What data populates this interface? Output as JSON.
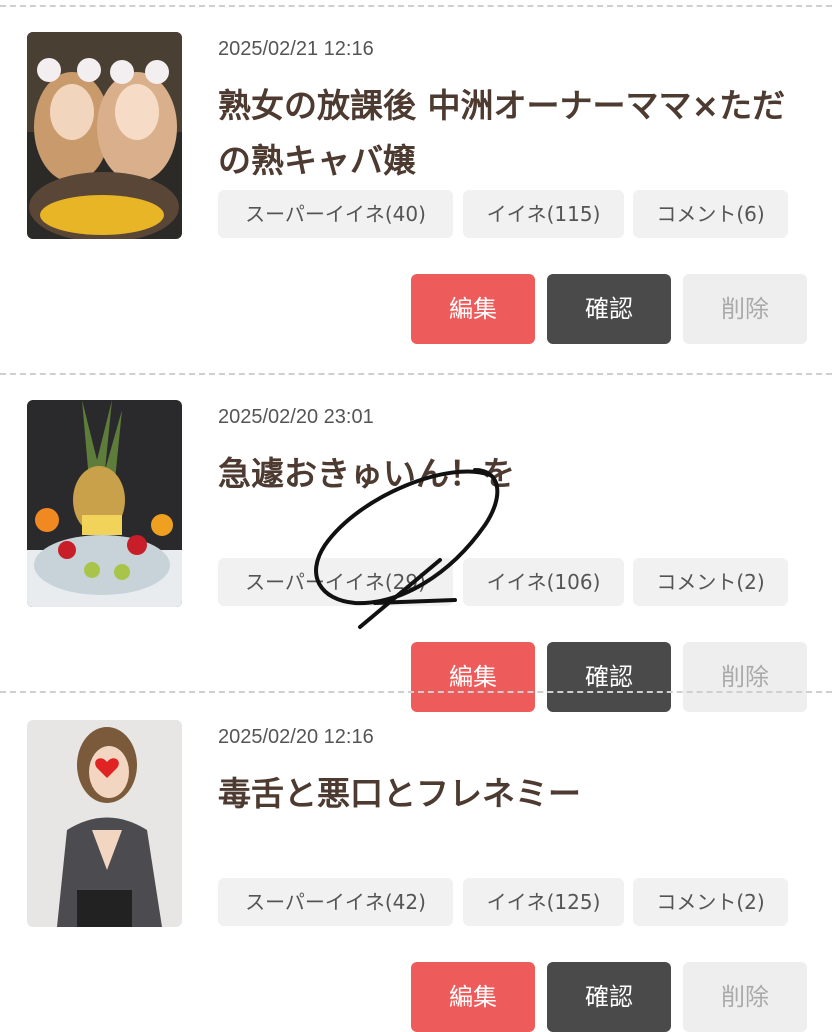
{
  "buttons": {
    "edit": "編集",
    "view": "確認",
    "delete": "削除"
  },
  "posts": [
    {
      "date": "2025/02/21 12:16",
      "title": "熟女の放課後 中洲オーナーママ×ただの熟キャバ嬢",
      "super_like": "スーパーイイネ(40)",
      "like": "イイネ(115)",
      "comment": "コメント(6)"
    },
    {
      "date": "2025/02/20 23:01",
      "title": "急遽おきゅいん！を",
      "super_like": "スーパーイイネ(29)",
      "like": "イイネ(106)",
      "comment": "コメント(2)"
    },
    {
      "date": "2025/02/20 12:16",
      "title": "毒舌と悪口とフレネミー",
      "super_like": "スーパーイイネ(42)",
      "like": "イイネ(125)",
      "comment": "コメント(2)"
    }
  ],
  "colors": {
    "edit": "#ee5b5b",
    "view": "#4a4a4a",
    "delete": "#eeeeee",
    "title": "#4d3b31"
  }
}
